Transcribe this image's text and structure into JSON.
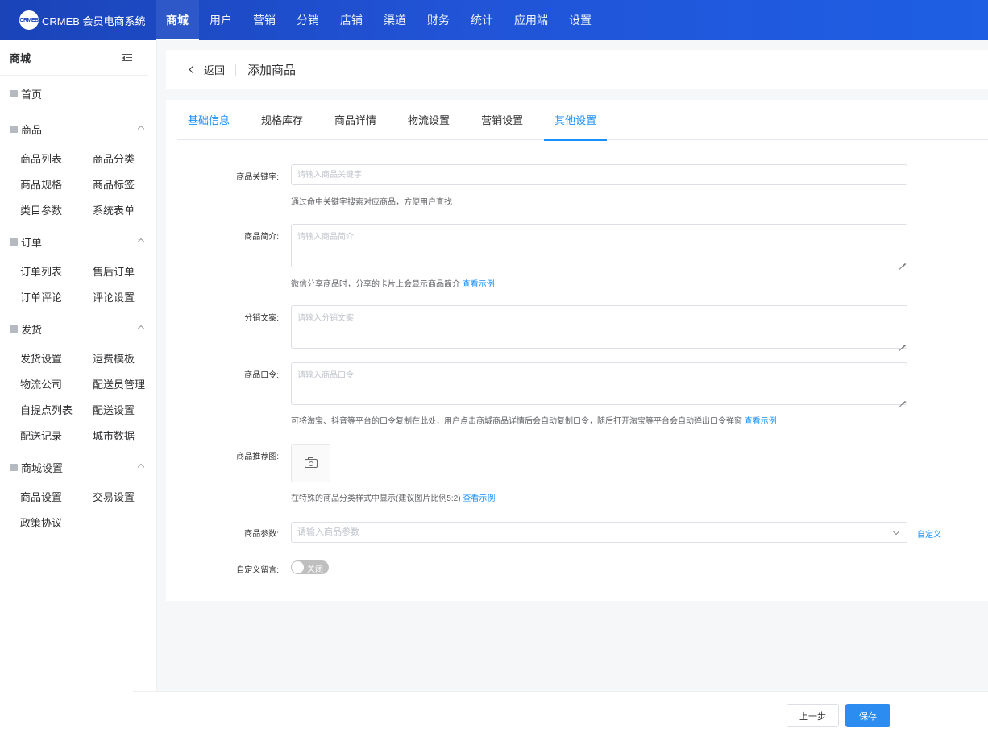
{
  "brand": {
    "logo_mark": "CRMEB",
    "name": "CRMEB 会员电商系统"
  },
  "topnav": [
    {
      "label": "商城",
      "active": true
    },
    {
      "label": "用户"
    },
    {
      "label": "营销"
    },
    {
      "label": "分销"
    },
    {
      "label": "店铺"
    },
    {
      "label": "渠道"
    },
    {
      "label": "财务"
    },
    {
      "label": "统计"
    },
    {
      "label": "应用端"
    },
    {
      "label": "设置"
    }
  ],
  "sidebar": {
    "title": "商城",
    "home": "首页",
    "groups": [
      {
        "title": "商品",
        "items": [
          "商品列表",
          "商品分类",
          "商品规格",
          "商品标签",
          "类目参数",
          "系统表单"
        ]
      },
      {
        "title": "订单",
        "items": [
          "订单列表",
          "售后订单",
          "订单评论",
          "评论设置"
        ]
      },
      {
        "title": "发货",
        "items": [
          "发货设置",
          "运费模板",
          "物流公司",
          "配送员管理",
          "自提点列表",
          "配送设置",
          "配送记录",
          "城市数据"
        ]
      },
      {
        "title": "商城设置",
        "items": [
          "商品设置",
          "交易设置",
          "政策协议"
        ]
      }
    ]
  },
  "header": {
    "back": "返回",
    "title": "添加商品"
  },
  "tabs": [
    {
      "label": "基础信息",
      "active": true
    },
    {
      "label": "规格库存"
    },
    {
      "label": "商品详情"
    },
    {
      "label": "物流设置"
    },
    {
      "label": "营销设置"
    },
    {
      "label": "其他设置",
      "active": true,
      "current": true
    }
  ],
  "form": {
    "keyword": {
      "label": "商品关键字:",
      "placeholder": "请输入商品关键字",
      "hint": "通过命中关键字搜索对应商品，方便用户查找"
    },
    "intro": {
      "label": "商品简介:",
      "placeholder": "请输入商品简介",
      "hint": "微信分享商品时，分享的卡片上会显示商品简介",
      "link": "查看示例"
    },
    "share_copy": {
      "label": "分销文案:",
      "placeholder": "请输入分销文案"
    },
    "command": {
      "label": "商品口令:",
      "placeholder": "请输入商品口令",
      "hint": "可将淘宝、抖音等平台的口令复制在此处，用户点击商城商品详情后会自动复制口令，随后打开淘宝等平台会自动弹出口令弹窗",
      "link": "查看示例"
    },
    "recommend_img": {
      "label": "商品推荐图:",
      "hint": "在特殊的商品分类样式中显示(建议图片比例5:2)",
      "link": "查看示例"
    },
    "params": {
      "label": "商品参数:",
      "placeholder": "请输入商品参数",
      "custom": "自定义"
    },
    "custom_msg": {
      "label": "自定义留言:",
      "switch_text": "关闭"
    }
  },
  "footer": {
    "prev": "上一步",
    "save": "保存"
  }
}
